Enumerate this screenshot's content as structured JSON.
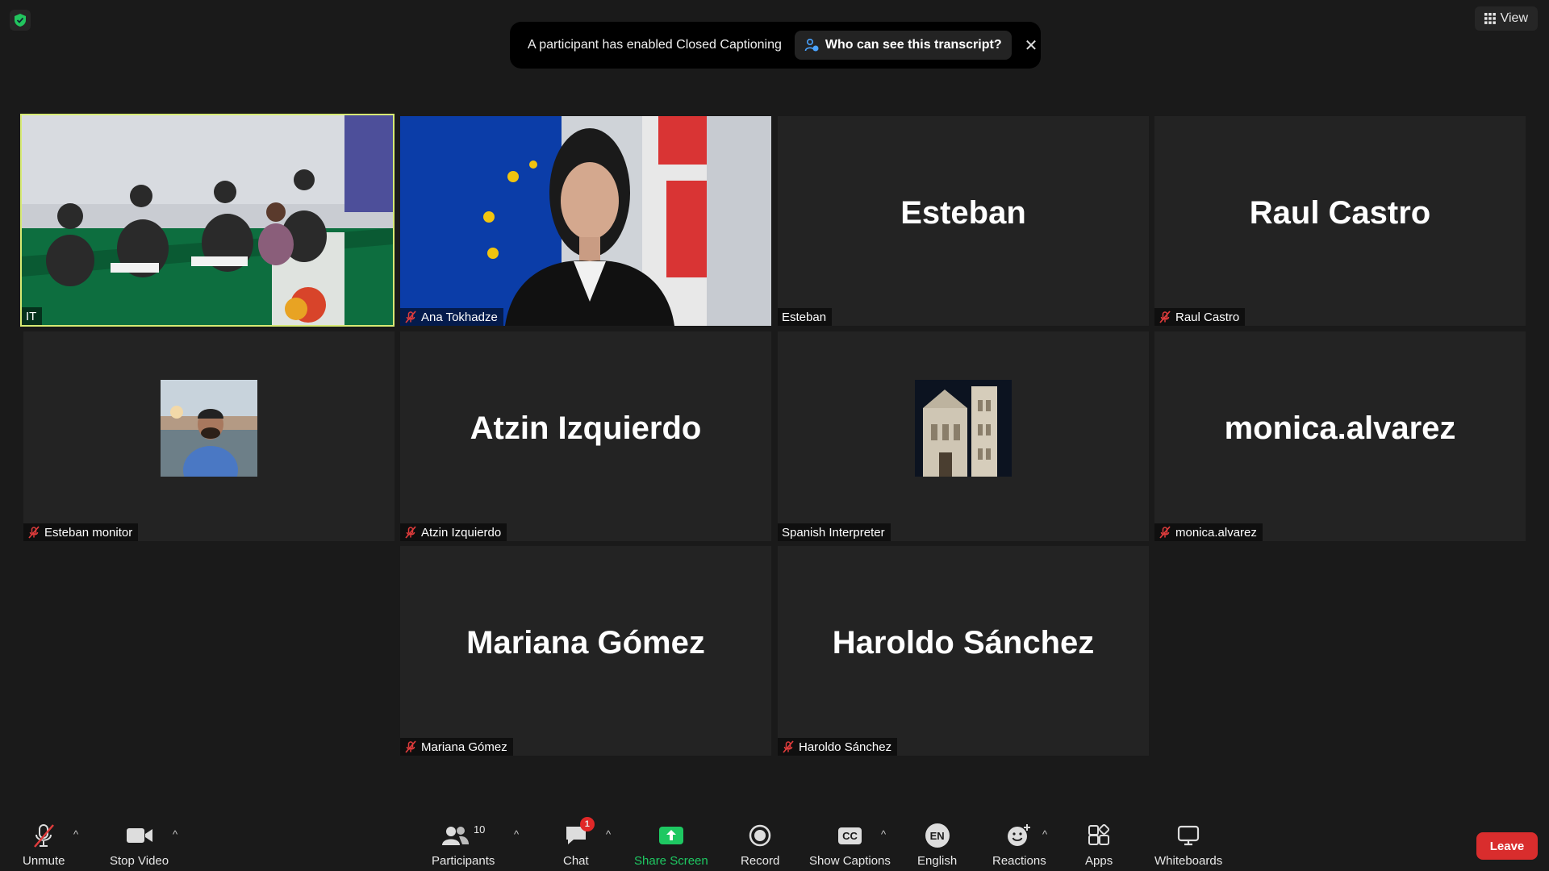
{
  "topbar": {
    "view_label": "View",
    "banner": {
      "text": "A participant has enabled Closed Captioning",
      "link_label": "Who can see this transcript?",
      "close_glyph": "✕"
    }
  },
  "tiles": [
    {
      "name": "IT",
      "big": "",
      "muted": false,
      "video": "panel"
    },
    {
      "name": "Ana Tokhadze",
      "big": "",
      "muted": true,
      "video": "speaker"
    },
    {
      "name": "Esteban",
      "big": "Esteban",
      "muted": false
    },
    {
      "name": "Raul Castro",
      "big": "Raul Castro",
      "muted": true
    },
    {
      "name": "Esteban monitor",
      "big": "",
      "muted": true,
      "avatar": "beach"
    },
    {
      "name": "Atzin Izquierdo",
      "big": "Atzin Izquierdo",
      "muted": true
    },
    {
      "name": "Spanish Interpreter",
      "big": "",
      "muted": false,
      "avatar": "cathedral"
    },
    {
      "name": "monica.alvarez",
      "big": "monica.alvarez",
      "muted": true
    },
    {
      "name": "Mariana Gómez",
      "big": "Mariana Gómez",
      "muted": true
    },
    {
      "name": "Haroldo Sánchez",
      "big": "Haroldo Sánchez",
      "muted": true
    }
  ],
  "toolbar": {
    "unmute": "Unmute",
    "stop_video": "Stop Video",
    "participants": "Participants",
    "participants_count": "10",
    "chat": "Chat",
    "chat_badge": "1",
    "share_screen": "Share Screen",
    "record": "Record",
    "show_captions": "Show Captions",
    "captions_glyph": "CC",
    "english": "English",
    "english_glyph": "EN",
    "reactions": "Reactions",
    "apps": "Apps",
    "whiteboards": "Whiteboards",
    "leave": "Leave",
    "caret_glyph": "^"
  },
  "colors": {
    "active_speaker_border": "#d7ea74",
    "share_screen_green": "#1ec862",
    "leave_red": "#d92d2d",
    "mute_red": "#e03c3c"
  }
}
